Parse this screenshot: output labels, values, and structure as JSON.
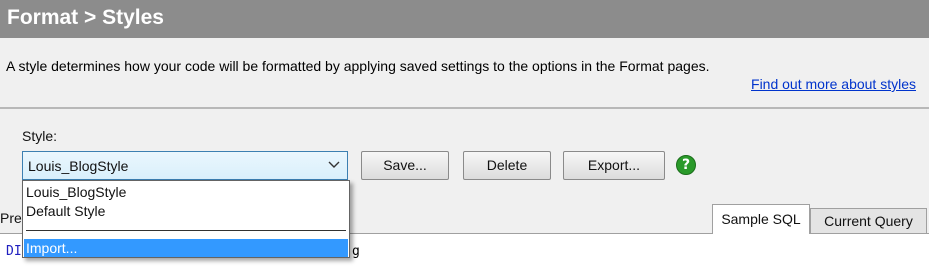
{
  "header": {
    "title": "Format > Styles"
  },
  "description": "A style determines how your code will be formatted by applying saved settings to the options in the Format pages.",
  "learn_more_link": "Find out more about styles",
  "style_section": {
    "label": "Style:",
    "selected": "Louis_BlogStyle",
    "options": [
      "Louis_BlogStyle",
      "Default Style"
    ],
    "import_label": "Import..."
  },
  "buttons": {
    "save": "Save...",
    "delete": "Delete",
    "export": "Export..."
  },
  "help_icon": {
    "glyph": "?",
    "color": "#2a9a2a"
  },
  "preview": {
    "label_partial": "Pre",
    "tabs": [
      "Sample SQL",
      "Current Query"
    ],
    "active_tab": "Sample SQL",
    "code_prefix": "DI",
    "code_tail": "g"
  },
  "colors": {
    "accent": "#3399ff",
    "title_bar": "#8c8c8c",
    "link": "#0033cc"
  }
}
